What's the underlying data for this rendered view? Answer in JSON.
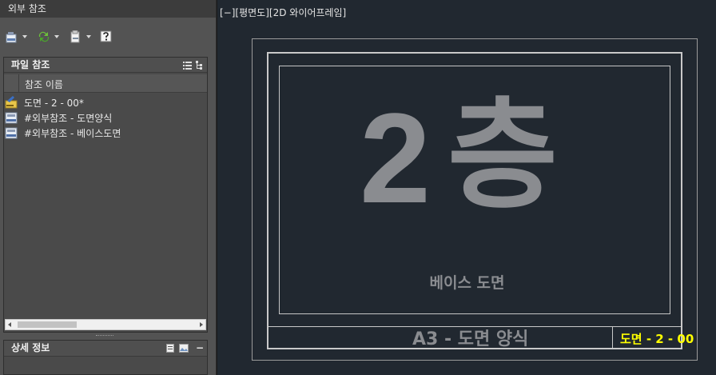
{
  "palette": {
    "title": "외부 참조",
    "file_refs": {
      "header": "파일 참조",
      "column_header": "참조 이름",
      "rows": [
        {
          "name": "도면 - 2 - 00*",
          "icon": "current-drawing-icon"
        },
        {
          "name": "#외부참조 - 도면양식",
          "icon": "dwg-reference-icon"
        },
        {
          "name": "#외부참조 - 베이스도면",
          "icon": "dwg-reference-icon"
        }
      ]
    },
    "details": {
      "header": "상세 정보"
    }
  },
  "viewport": {
    "label": "[−][평면도][2D 와이어프레임]",
    "floor_number": "2",
    "floor_suffix": "층",
    "sheet_name": "베이스 도면",
    "titleblock": "A3 - 도면 양식",
    "sheet_number": "도면 - 2 - 00"
  },
  "colors": {
    "viewport_bg": "#212830",
    "palette_bg": "#535353",
    "drawing_text": "#8a8c90",
    "sheet_number": "#ffff00"
  }
}
